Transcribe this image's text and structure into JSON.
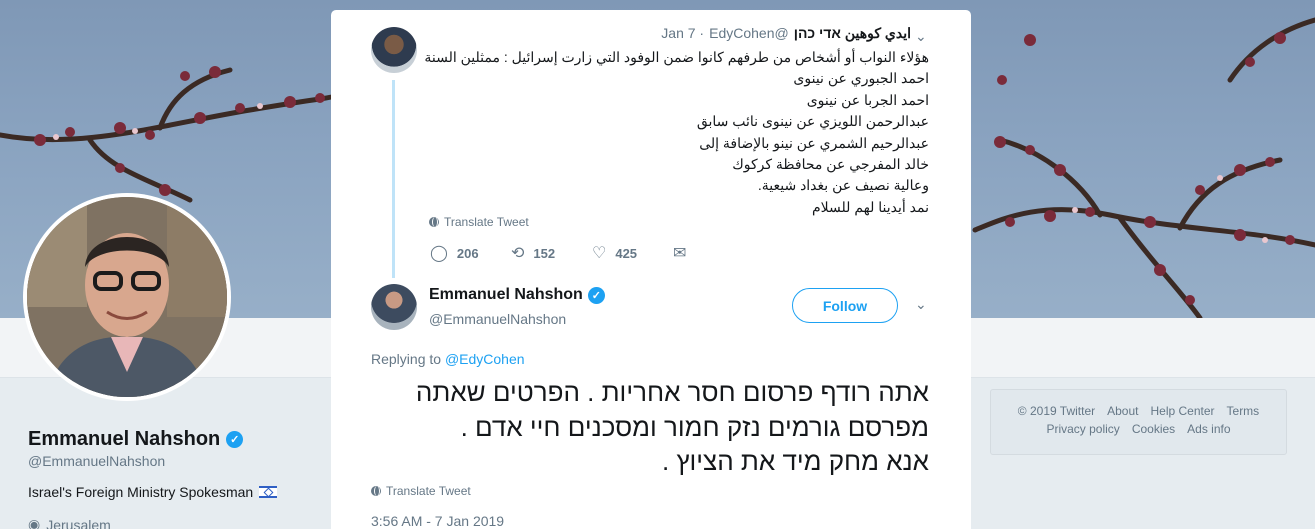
{
  "profile": {
    "name": "Emmanuel Nahshon",
    "handle": "@EmmanuelNahshon",
    "bio": "Israel's Foreign Ministry Spokesman",
    "location": "Jerusalem"
  },
  "footer": {
    "row1": [
      "© 2019 Twitter",
      "About",
      "Help Center",
      "Terms"
    ],
    "row2": [
      "Privacy policy",
      "Cookies",
      "Ads info"
    ]
  },
  "parent_tweet": {
    "author_name": "ايدي كوهين אדי כהן",
    "author_handle": "@EdyCohen",
    "date": "· Jan 7",
    "lines": [
      "هؤلاء النواب  أو أشخاص من طرفهم كانوا ضمن الوفود التي زارت إسرائيل : ممثلين السنة",
      "احمد الجبوري عن نينوى",
      "احمد الجربا عن نينوى",
      "عبدالرحمن اللويزي عن نينوى نائب سابق",
      "عبدالرحيم الشمري عن نينو بالإضافة إلى",
      "خالد المفرجي عن محافظة كركوك",
      "وعالية نصيف عن بغداد شيعية.",
      "نمد أيدينا لهم للسلام"
    ],
    "translate": "Translate Tweet",
    "replies": "206",
    "retweets": "152",
    "likes": "425"
  },
  "main_tweet": {
    "author_name": "Emmanuel Nahshon",
    "author_handle": "@EmmanuelNahshon",
    "follow_label": "Follow",
    "replying_prefix": "Replying to",
    "replying_to": "@EdyCohen",
    "lines": [
      "אתה רודף פרסום חסר אחריות . הפרטים שאתה",
      "מפרסם גורמים נזק חמור ומסכנים חיי אדם .",
      "אנא מחק מיד את הציוץ ."
    ],
    "translate": "Translate Tweet",
    "timestamp": "3:56 AM - 7 Jan 2019"
  },
  "icons": {
    "reply": "reply-icon",
    "retweet": "retweet-icon",
    "like": "heart-icon",
    "dm": "envelope-icon",
    "translate": "globe-icon",
    "verified": "verified-badge-icon",
    "location": "location-pin-icon",
    "caret": "chevron-down-icon"
  },
  "colors": {
    "accent": "#1da1f2",
    "thread_line": "#bfe3f8",
    "muted": "#657786"
  }
}
